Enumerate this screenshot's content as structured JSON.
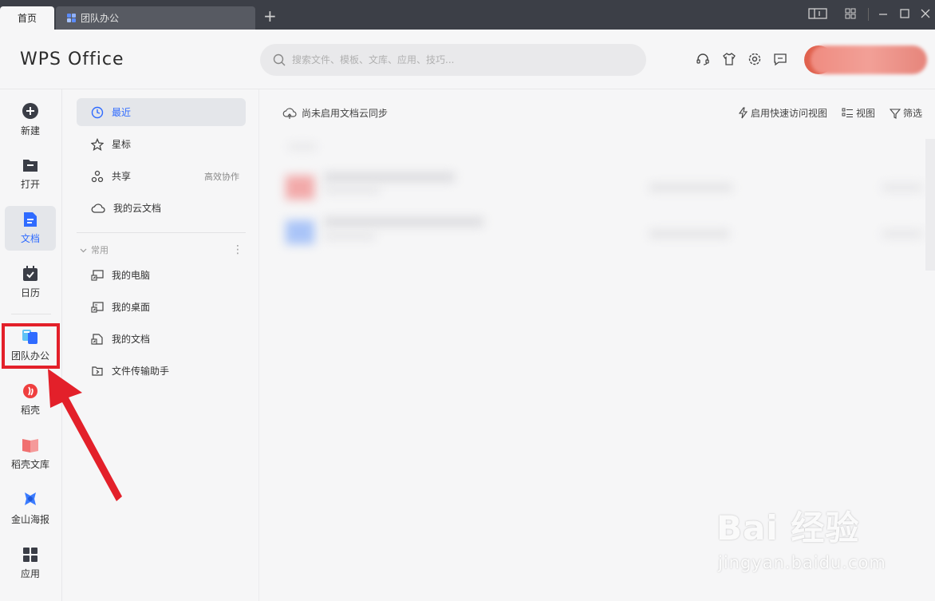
{
  "tabs": [
    {
      "label": "首页",
      "active": true
    },
    {
      "label": "团队办公",
      "active": false
    }
  ],
  "app": {
    "logo_text": "WPS Office"
  },
  "search": {
    "placeholder": "搜索文件、模板、文库、应用、技巧..."
  },
  "header_icons": [
    "headset-icon",
    "skin-icon",
    "settings-icon",
    "message-icon"
  ],
  "rail": {
    "items": [
      {
        "label": "新建",
        "icon": "plus-circle-icon"
      },
      {
        "label": "打开",
        "icon": "folder-icon"
      },
      {
        "label": "文档",
        "icon": "document-icon",
        "active": true
      },
      {
        "label": "日历",
        "icon": "calendar-icon"
      },
      {
        "label": "团队办公",
        "icon": "team-icon"
      },
      {
        "label": "稻壳",
        "icon": "docer-icon"
      },
      {
        "label": "稻壳文库",
        "icon": "library-icon"
      },
      {
        "label": "金山海报",
        "icon": "poster-icon"
      },
      {
        "label": "应用",
        "icon": "apps-icon"
      }
    ]
  },
  "nav": {
    "items": [
      {
        "label": "最近",
        "icon": "clock-icon",
        "active": true
      },
      {
        "label": "星标",
        "icon": "star-icon"
      },
      {
        "label": "共享",
        "icon": "share-icon",
        "aside": "高效协作"
      },
      {
        "label": "我的云文档",
        "icon": "cloud-icon"
      }
    ],
    "section_label": "常用",
    "common": [
      {
        "label": "我的电脑",
        "icon": "computer-shortcut-icon"
      },
      {
        "label": "我的桌面",
        "icon": "desktop-shortcut-icon"
      },
      {
        "label": "我的文档",
        "icon": "documents-shortcut-icon"
      },
      {
        "label": "文件传输助手",
        "icon": "transfer-icon"
      }
    ]
  },
  "main": {
    "sync_text": "尚未启用文档云同步",
    "toolbar": {
      "quick_access": "启用快速访问视图",
      "view": "视图",
      "filter": "筛选"
    }
  },
  "watermark": {
    "main": "Bai 经验",
    "sub": "jingyan.baidu.com"
  },
  "colors": {
    "accent": "#2f6bff",
    "titlebar": "#3c3f47",
    "highlight": "#e3202a"
  }
}
